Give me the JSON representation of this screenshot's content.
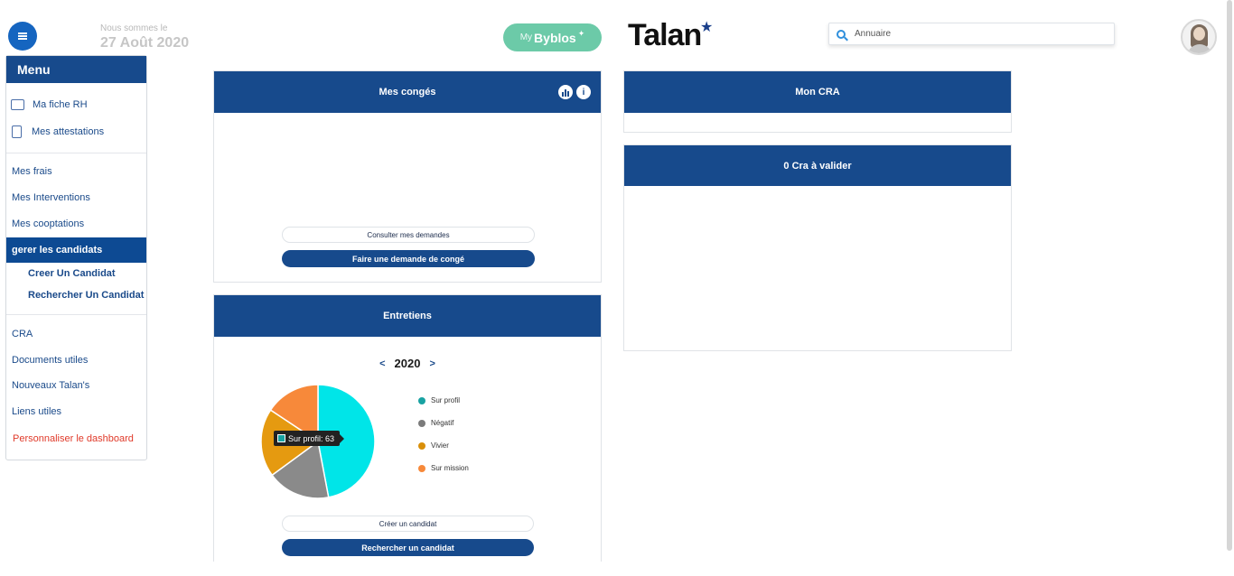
{
  "header": {
    "date_label": "Nous sommes le",
    "date_value": "27 Août 2020",
    "mybyblos_my": "My",
    "mybyblos_name": "Byblos",
    "logo_text": "Talan",
    "search_placeholder": "Annuaire"
  },
  "sidebar": {
    "title": "Menu",
    "items": [
      {
        "label": "Ma fiche RH"
      },
      {
        "label": "Mes attestations"
      },
      {
        "label": "Mes frais"
      },
      {
        "label": "Mes Interventions"
      },
      {
        "label": "Mes cooptations"
      },
      {
        "label": "gerer les candidats"
      },
      {
        "label": "Creer Un Candidat"
      },
      {
        "label": "Rechercher Un Candidat"
      },
      {
        "label": "CRA"
      },
      {
        "label": "Documents utiles"
      },
      {
        "label": "Nouveaux Talan's"
      },
      {
        "label": "Liens utiles"
      },
      {
        "label": "Personnaliser le dashboard"
      }
    ]
  },
  "conges": {
    "title": "Mes congés",
    "info_icon": "i",
    "consult_label": "Consulter mes demandes",
    "request_label": "Faire une demande de congé"
  },
  "cra": {
    "title": "Mon CRA"
  },
  "cra_valider": {
    "title": "0 Cra à valider"
  },
  "entretiens": {
    "title": "Entretiens",
    "year": "2020",
    "prev": "<",
    "next": ">",
    "tooltip": "Sur profil: 63",
    "create_label": "Créer un candidat",
    "search_label": "Rechercher un candidat"
  },
  "chart_data": {
    "type": "pie",
    "title": "",
    "categories": [
      "Sur profil",
      "Négatif",
      "Vivier",
      "Sur mission"
    ],
    "values": [
      63,
      24,
      26,
      21
    ],
    "colors": [
      "#00e5e8",
      "#8a8a8a",
      "#e59a10",
      "#f7893a"
    ],
    "legend_colors": [
      "#18a2a2",
      "#7b7b7b",
      "#d98f0a",
      "#f7893a"
    ],
    "legend": "right"
  }
}
